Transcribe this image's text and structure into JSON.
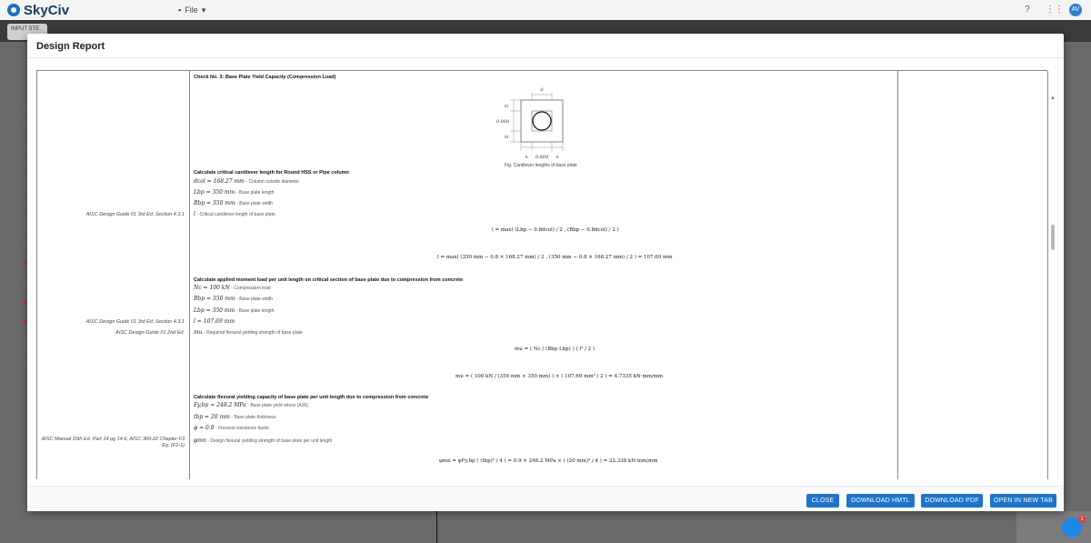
{
  "app": {
    "logo_text": "SkyCiv",
    "file_menu": "File",
    "input_tab": "INPUT STE",
    "avatar_initials": "AV",
    "chat_badge": "1"
  },
  "status_icons": [
    {
      "kind": "ok",
      "glyph": "✓"
    },
    {
      "kind": "ok",
      "glyph": "✓"
    },
    {
      "kind": "ok",
      "glyph": "✓"
    },
    {
      "kind": "ok",
      "glyph": "✓"
    },
    {
      "kind": "ok",
      "glyph": "✓"
    },
    {
      "kind": "ok",
      "glyph": "✓"
    },
    {
      "kind": "ok",
      "glyph": "✓"
    },
    {
      "kind": "ok",
      "glyph": "✓"
    },
    {
      "kind": "fail",
      "glyph": "✕"
    },
    {
      "kind": "ok",
      "glyph": "✓"
    },
    {
      "kind": "fail",
      "glyph": "✕"
    },
    {
      "kind": "fail",
      "glyph": "✕"
    },
    {
      "kind": "ok",
      "glyph": "✓"
    },
    {
      "kind": "ok",
      "glyph": "✓"
    }
  ],
  "modal": {
    "title": "Design Report",
    "buttons": {
      "close": "CLOSE",
      "download_html": "DOWNLOAD HMTL",
      "download_pdf": "DOWNLOAD PDF",
      "open_new_tab": "OPEN IN NEW TAB"
    }
  },
  "report": {
    "check_title": "Check No. 3: Base Plate Yield Capacity (Compression Load)",
    "figure": {
      "caption": "Fig. Cantilever lengths of base plate",
      "labels": {
        "d": "d",
        "m_top": "m",
        "m_bottom": "m",
        "dim_side": "0.80d",
        "n_left": "n",
        "n_mid": "0.80d",
        "n_right": "n"
      }
    },
    "sections": [
      {
        "heading": "Calculate critical cantilever length for Round HSS or Pipe column",
        "items": [
          {
            "sym": "dcol = 168.27 mm",
            "desc": "- Column outside diameter",
            "ref": ""
          },
          {
            "sym": "Lbp = 350 mm",
            "desc": "- Base plate length",
            "ref": ""
          },
          {
            "sym": "Bbp = 350 mm",
            "desc": "- Base plate width",
            "ref": ""
          },
          {
            "sym": "l",
            "desc": "- Critical cantilever length of base plate",
            "ref": "AISC Design Guide 01 3rd Ed. Section 4.3.1"
          }
        ],
        "equations": [
          "l = max( (Lbp − 0.8dcol) / 2 , (Bbp − 0.8dcol) / 2 )",
          "l = max( (350 mm − 0.8 × 168.27 mm) / 2 , (350 mm − 0.8 × 168.27 mm) / 2 ) = 107.69 mm"
        ]
      },
      {
        "heading": "Calculate applied moment load per unit length on critical section of base plate due to compression from concrete",
        "items": [
          {
            "sym": "Nc = 100 kN",
            "desc": "- Compression load",
            "ref": ""
          },
          {
            "sym": "Bbp = 350 mm",
            "desc": "- Base plate width",
            "ref": ""
          },
          {
            "sym": "Lbp = 350 mm",
            "desc": "- Base plate length",
            "ref": ""
          },
          {
            "sym": "l = 107.69 mm",
            "desc": "",
            "ref": "AISC Design Guide 01 3rd Ed. Section 4.3.1"
          },
          {
            "sym": "mu",
            "desc": "- Required flexural yielding strength of base plate",
            "ref": "AISC Design Guide 01 2nd Ed."
          }
        ],
        "equations": [
          "mu = ( Nc / (Bbp Lbp) ) ( l² / 2 )",
          "mu = ( 100 kN / (350 mm × 350 mm) ) × ( 107.69 mm² / 2 ) = 4.7335 kN·mm/mm"
        ]
      },
      {
        "heading": "Calculate flexural yielding capacity of base plate per unit length due to compression from concrete",
        "items": [
          {
            "sym": "Fy,bp = 248.2 MPa",
            "desc": "- Base plate yield stress (A36)",
            "ref": ""
          },
          {
            "sym": "tbp = 20 mm",
            "desc": "- Base plate thickness",
            "ref": ""
          },
          {
            "sym": "φ = 0.9",
            "desc": "- Flexural resistance factor",
            "ref": ""
          },
          {
            "sym": "φmn",
            "desc": "- Design flexural yielding strength of base plate per unit length",
            "ref": "AISC Manual 15th Ed. Part 14 pg 14-6, AISC 360-22 Chapter F3 Eq. (F2-1)"
          }
        ],
        "equations": [
          "φmn = φFy,bp ( (tbp)² / 4 ) = 0.9 × 248.2 MPa × ( (20 mm)² / 4 ) = 22.338 kN·mm/mm"
        ]
      }
    ]
  }
}
